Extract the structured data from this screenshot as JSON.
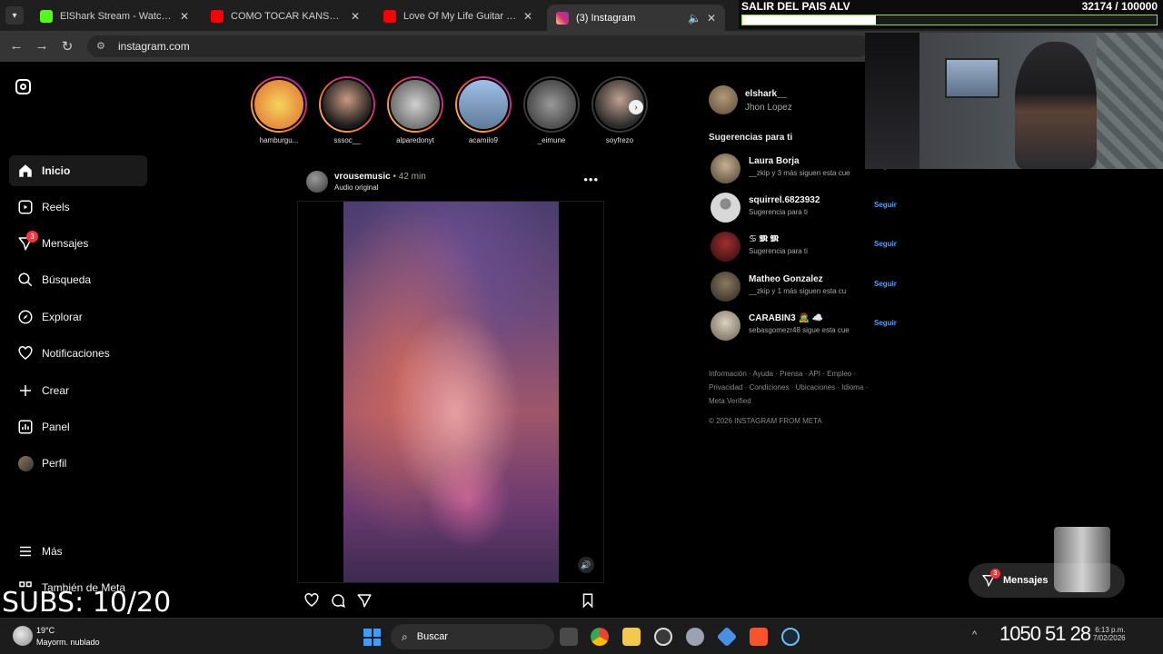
{
  "browser": {
    "tabs": [
      {
        "label": "ElShark Stream - Watch Live on",
        "favicon_color": "#53fc18",
        "active": false
      },
      {
        "label": "COMO TOCAR KANSAS DUST IN",
        "favicon_color": "#ff0000",
        "active": false
      },
      {
        "label": "Love Of My Life Guitar Cover A",
        "favicon_color": "#ff0000",
        "active": false
      },
      {
        "label": "(3) Instagram",
        "favicon_color": "#d62976",
        "active": true
      }
    ],
    "url": "instagram.com"
  },
  "sidebar": {
    "items": [
      {
        "label": "Inicio",
        "icon": "home-icon",
        "active": true
      },
      {
        "label": "Reels",
        "icon": "reels-icon"
      },
      {
        "label": "Mensajes",
        "icon": "messages-icon",
        "badge": "3"
      },
      {
        "label": "Búsqueda",
        "icon": "search-icon"
      },
      {
        "label": "Explorar",
        "icon": "explore-icon"
      },
      {
        "label": "Notificaciones",
        "icon": "heart-icon"
      },
      {
        "label": "Crear",
        "icon": "plus-icon"
      },
      {
        "label": "Panel",
        "icon": "dashboard-icon"
      },
      {
        "label": "Perfil",
        "icon": "profile-avatar"
      }
    ],
    "more_label": "Más",
    "meta_label": "También de Meta"
  },
  "stories": [
    {
      "name": "hamburgu...",
      "seen": false,
      "color": "#e8c040"
    },
    {
      "name": "sssoc__",
      "seen": false,
      "color": "#2a2a2a"
    },
    {
      "name": "alparedonyt",
      "seen": false,
      "color": "#8a8a8a"
    },
    {
      "name": "acamilo9",
      "seen": false,
      "color": "#7a95b5"
    },
    {
      "name": "_eimune",
      "seen": true,
      "color": "#555555"
    },
    {
      "name": "soyfrezo",
      "seen": true,
      "color": "#444444"
    }
  ],
  "post": {
    "username": "vrousemusic",
    "time": "• 42 min",
    "audio": "Audio original"
  },
  "profile": {
    "username": "elshark__",
    "name": "Jhon Lopez"
  },
  "suggestions": {
    "title": "Sugerencias para ti",
    "follow_label": "Seguir",
    "items": [
      {
        "username": "Laura Borja",
        "sub": "__zkip y 3 más siguen esta cue",
        "color": "#6a6048"
      },
      {
        "username": "squirrel.6823932",
        "sub": "Sugerencia para ti",
        "color": "#c8c8c8"
      },
      {
        "username": "♋ 𝕸 𝕸",
        "sub": "Sugerencia para ti",
        "color": "#6a1a1a"
      },
      {
        "username": "Matheo Gonzalez",
        "sub": "__zkip y 1 más siguen esta cu",
        "color": "#5a4a3a"
      },
      {
        "username": "CARABIN3 🧟 ☁️",
        "sub": "sebasgomezr48 sigue esta cue",
        "color": "#8a8070"
      }
    ]
  },
  "footer": {
    "links": "Información · Ayuda · Prensa · API · Empleo · Privacidad · Condiciones · Ubicaciones · Idioma · Meta Verified",
    "copyright": "© 2026 INSTAGRAM FROM META"
  },
  "overlay": {
    "title": "SALIR DEL PAIS ALV",
    "count": "32174 / 100000",
    "progress": 0.32174,
    "subs": "SUBS: 10/20"
  },
  "messages_pill": {
    "label": "Mensajes",
    "badge": "3"
  },
  "taskbar": {
    "temp": "19°C",
    "weather": "Mayorm. nublado",
    "search_placeholder": "Buscar",
    "clock": "1050 51 28",
    "time_small": "6:13 p.m.",
    "date_small": "7/02/2026"
  }
}
